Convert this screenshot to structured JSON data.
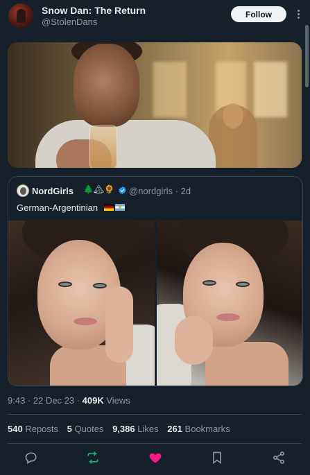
{
  "tweet": {
    "author": {
      "display_name": "Snow Dan: The Return",
      "handle": "@StolenDans"
    },
    "follow_label": "Follow",
    "timestamp": "9:43 · 22 Dec 23 · ",
    "views_count": "409K",
    "views_label": " Views",
    "stats": {
      "reposts_count": "540",
      "reposts_label": "Reposts",
      "quotes_count": "5",
      "quotes_label": "Quotes",
      "likes_count": "9,386",
      "likes_label": "Likes",
      "bookmarks_count": "261",
      "bookmarks_label": "Bookmarks"
    },
    "liked": true,
    "colors": {
      "background": "#15202b",
      "text_primary": "#e7e9ea",
      "text_secondary": "#8b98a5",
      "border": "#38444d",
      "verified_blue": "#1d9bf0",
      "repost_green": "#00ba7c",
      "like_pink": "#f91880"
    }
  },
  "quoted_tweet": {
    "display_name": "NordGirls",
    "emoji_tree": "🌲",
    "emoji_mountain": "🏔",
    "emoji_sun": "🌻",
    "handle_time": "@nordgirls · 2d",
    "text": "German-Argentinian",
    "verified": true
  },
  "icons": {
    "avatar": "avatar-image",
    "more": "more-dots-icon",
    "verified": "verified-badge-icon",
    "reply": "reply-icon",
    "repost": "repost-icon",
    "like": "heart-icon",
    "bookmark": "bookmark-icon",
    "share": "share-icon"
  }
}
